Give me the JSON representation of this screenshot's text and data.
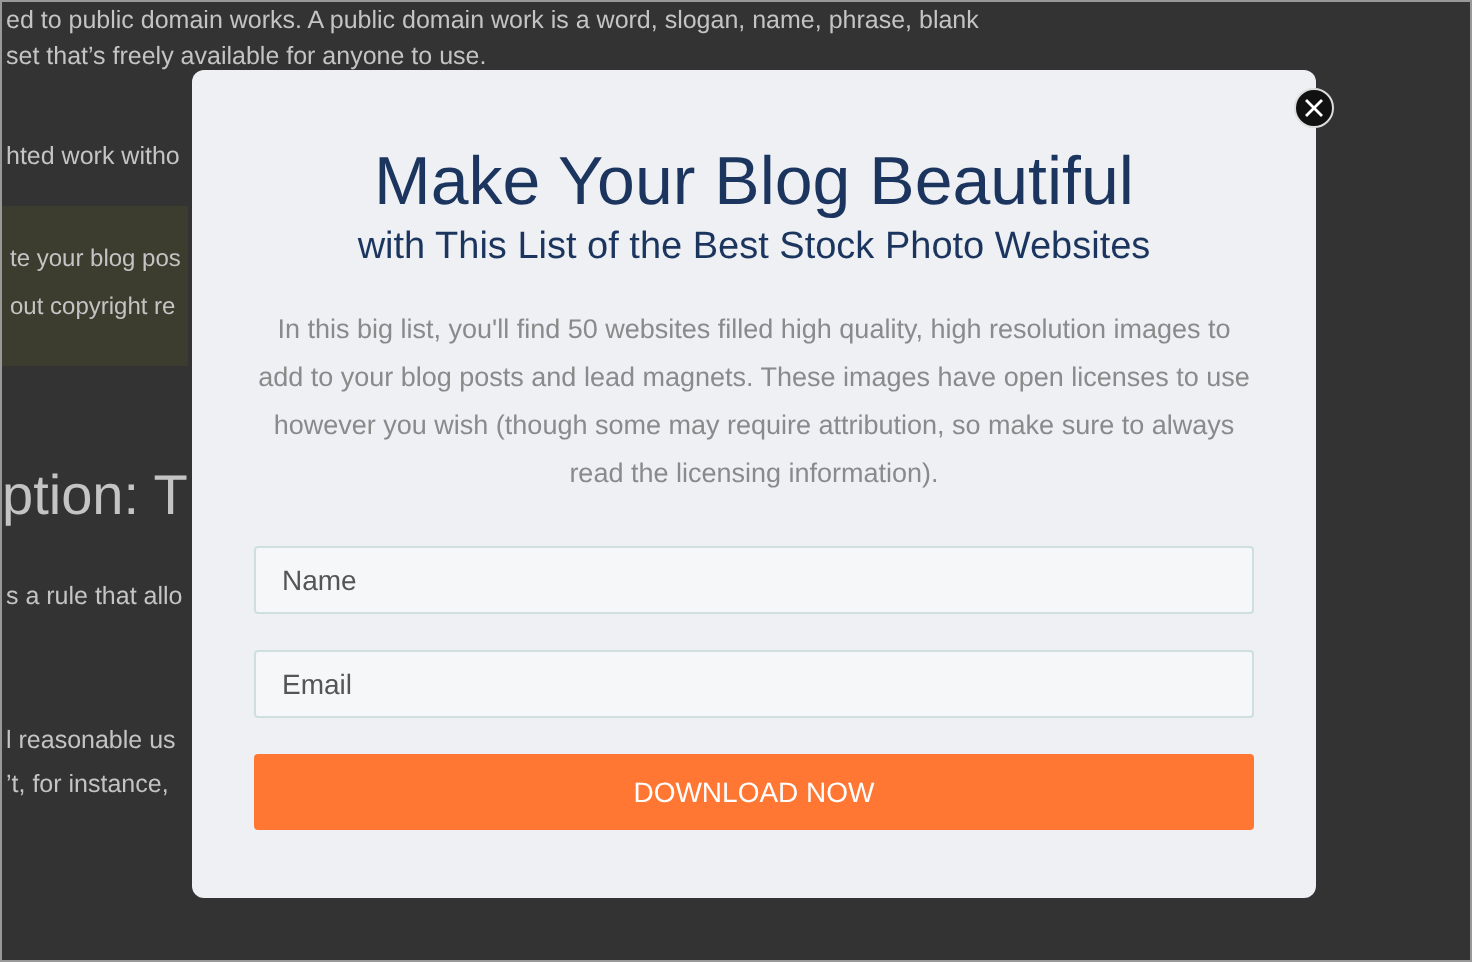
{
  "background_article": {
    "lines": [
      {
        "kind": "text",
        "text": "ed to public domain works. A public domain work is a word, slogan, name, phrase, blank"
      },
      {
        "kind": "text",
        "text": "set that’s freely available for anyone to use."
      },
      {
        "kind": "text",
        "text": "hted work witho"
      },
      {
        "kind": "callout",
        "lines": [
          "te your blog pos",
          "out copyright re"
        ]
      },
      {
        "kind": "heading",
        "text": "ption: T"
      },
      {
        "kind": "text",
        "text": "s a rule that allo"
      },
      {
        "kind": "text",
        "text": "l reasonable us"
      },
      {
        "kind": "text",
        "text": "’t, for instance,"
      }
    ]
  },
  "popup": {
    "title": "Make Your Blog Beautiful",
    "subtitle": "with This List of the Best Stock Photo Websites",
    "description": "In this big list, you'll find 50 websites filled high quality, high resolution images to add to your blog posts and lead magnets. These images have open licenses to use however you wish (though some may require attribution, so make sure to always read the licensing information).",
    "fields": [
      {
        "placeholder": "Name"
      },
      {
        "placeholder": "Email"
      }
    ],
    "button": "DOWNLOAD NOW"
  }
}
